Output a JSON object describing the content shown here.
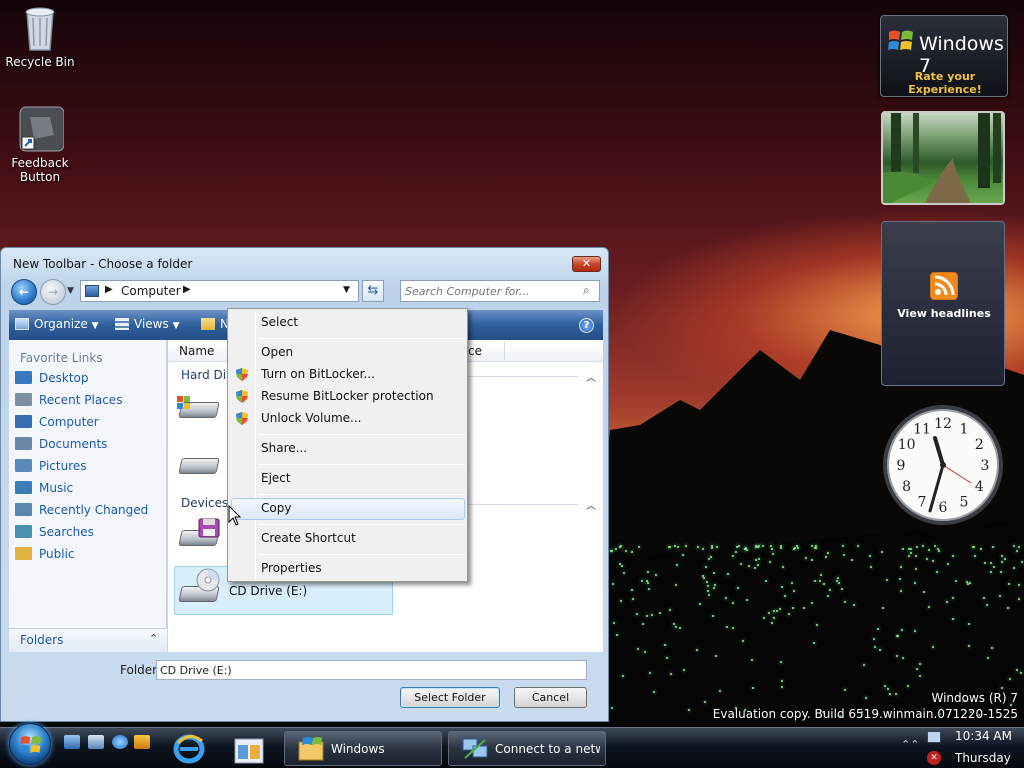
{
  "desktop": {
    "icons": [
      {
        "label": "Recycle Bin"
      },
      {
        "label": "Feedback Button"
      }
    ],
    "watermark_line1": "Windows (R) 7",
    "watermark_line2": "Evaluation copy. Build 6519.winmain.071220-1525"
  },
  "gadgets": {
    "win7_title": "Windows 7",
    "win7_subtitle": "Rate your Experience!",
    "rss_label": "View headlines",
    "clock_numbers": [
      "12",
      "1",
      "2",
      "3",
      "4",
      "5",
      "6",
      "7",
      "8",
      "9",
      "10",
      "11"
    ]
  },
  "dialog": {
    "title": "New Toolbar - Choose a folder",
    "close_glyph": "✕",
    "address_crumb": "Computer",
    "search_placeholder": "Search Computer for...",
    "toolbar": {
      "organize": "Organize",
      "views": "Views",
      "new_folder_partial": "N"
    },
    "favorite_links_header": "Favorite Links",
    "favorite_links": [
      {
        "label": "Desktop",
        "color": "#3b78c2"
      },
      {
        "label": "Recent Places",
        "color": "#7d8fa3"
      },
      {
        "label": "Computer",
        "color": "#3a6db0"
      },
      {
        "label": "Documents",
        "color": "#6d87a8"
      },
      {
        "label": "Pictures",
        "color": "#5a8ab8"
      },
      {
        "label": "Music",
        "color": "#3c7cb8"
      },
      {
        "label": "Recently Changed",
        "color": "#5b86ad"
      },
      {
        "label": "Searches",
        "color": "#4a8fb0"
      },
      {
        "label": "Public",
        "color": "#e0b440"
      }
    ],
    "folders_label": "Folders",
    "columns": {
      "name": "Name",
      "space_partial": "ce"
    },
    "groups": {
      "hard_disk_partial": "Hard Dis",
      "devices_partial": "Devices v"
    },
    "cd_drive_label": "CD Drive (E:)",
    "folder_label": "Folder:",
    "folder_value": "CD Drive (E:)",
    "select_folder": "Select Folder",
    "cancel": "Cancel"
  },
  "context_menu": {
    "items": [
      "Select",
      "Open",
      "Turn on BitLocker...",
      "Resume BitLocker protection",
      "Unlock Volume...",
      "Share...",
      "Eject",
      "Copy",
      "Create Shortcut",
      "Properties"
    ],
    "highlighted": "Copy"
  },
  "taskbar": {
    "tasks": [
      {
        "label": "Windows"
      },
      {
        "label": "Connect to a netwo"
      }
    ],
    "time": "10:34 AM",
    "day": "Thursday"
  }
}
